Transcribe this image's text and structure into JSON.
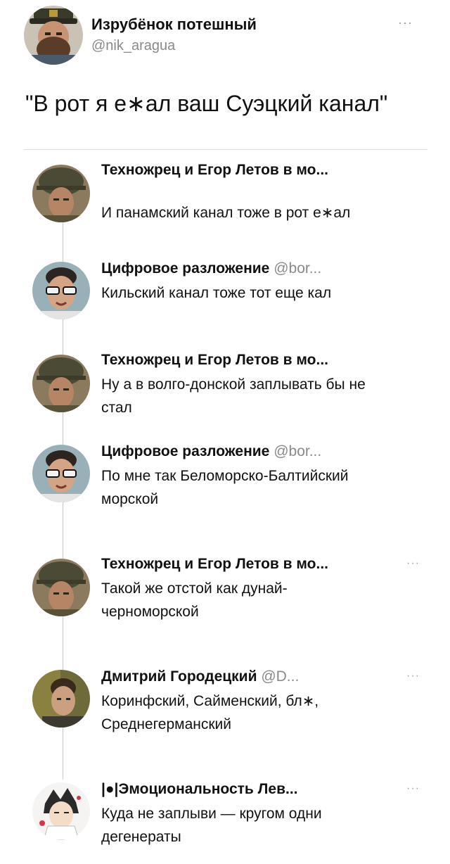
{
  "post": {
    "author_name": "Изрубёнок потешный",
    "handle": "@nik_aragua",
    "more": "···",
    "text": "\"В рот я е∗ал ваш Суэцкий канал\"",
    "avatar_icon": "bearded-man-in-cap-avatar"
  },
  "replies": [
    {
      "name": "Техножрец и Егор Летов в мо...",
      "handle": "",
      "text": "И панамский канал тоже в рот е∗ал",
      "more": "",
      "avatar_icon": "soldier-helmet-avatar"
    },
    {
      "name": "Цифровое разложение",
      "handle": "@bor...",
      "text": "Кильский канал тоже тот еще кал",
      "more": "",
      "avatar_icon": "man-sunglasses-avatar"
    },
    {
      "name": "Техножрец и Егор Летов в мо...",
      "handle": "",
      "text": "Ну а в волго-донской заплывать бы не\nстал",
      "more": "",
      "avatar_icon": "soldier-helmet-avatar"
    },
    {
      "name": "Цифровое разложение",
      "handle": "@bor...",
      "text": "По мне так Беломорско-Балтийский\nморской",
      "more": "",
      "avatar_icon": "man-sunglasses-avatar"
    },
    {
      "name": "Техножрец и Егор Летов в мо...",
      "handle": "",
      "text": "Такой же отстой как дунай-\nчерноморской",
      "more": "···",
      "avatar_icon": "soldier-helmet-avatar"
    },
    {
      "name": "Дмитрий Городецкий",
      "handle": "@D...",
      "text": "Коринфский, Сайменский, бл∗,\nСреднегерманский",
      "more": "···",
      "avatar_icon": "man-portrait-avatar"
    },
    {
      "name": "|●|Эмоциональность Лев...",
      "handle": "",
      "text": "Куда не заплыви — кругом одни\nдегенераты",
      "more": "···",
      "avatar_icon": "anime-character-avatar"
    }
  ]
}
